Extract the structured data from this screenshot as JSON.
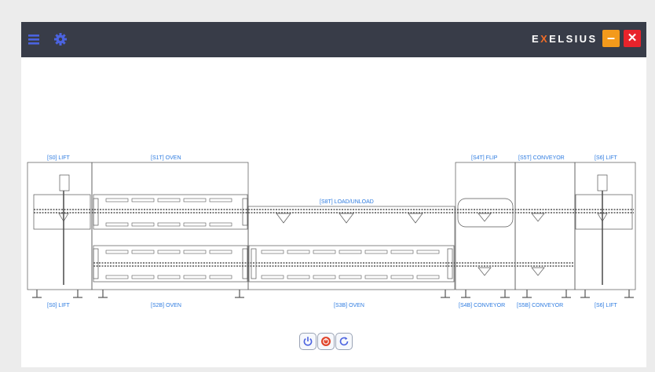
{
  "app": {
    "brand_prefix": "E",
    "brand_x": "X",
    "brand_suffix": "ELSIUS",
    "colors": {
      "titlebar": "#383c48",
      "accent": "#4b63e0",
      "minimize": "#f39a1c",
      "close": "#e8232b",
      "zone_label": "#2d7be0",
      "stop_button": "#e0442b"
    }
  },
  "titlebar": {
    "menu_icon": "hamburger-icon",
    "settings_icon": "gear-icon",
    "minimize_label": "–",
    "close_label": "✕"
  },
  "zones": {
    "lift_top_left": "[S0] LIFT",
    "oven_top": "[S1T] OVEN",
    "load_unload": "[S8T] LOAD/UNLOAD",
    "flip_top": "[S4T] FLIP",
    "conveyor_top": "[S5T] CONVEYOR",
    "lift_top_right": "[S6] LIFT",
    "lift_bottom_left": "[S0] LIFT",
    "oven_bottom_left": "[S2B] OVEN",
    "oven_bottom_mid": "[S3B] OVEN",
    "conveyor_bottom_1": "[S4B] CONVEYOR",
    "conveyor_bottom_2": "[S5B] CONVEYOR",
    "lift_bottom_right": "[S6] LIFT"
  },
  "controls": {
    "power_icon": "power-icon",
    "stop_icon": "stop-icon",
    "reset_icon": "refresh-icon"
  }
}
